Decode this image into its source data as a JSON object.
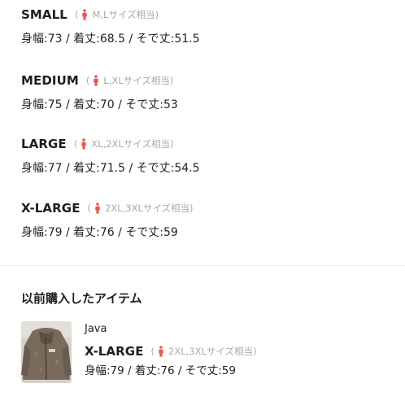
{
  "sizes": [
    {
      "name": "SMALL",
      "equiv_open": "(",
      "equiv_text": "M,Lサイズ相当)",
      "measurements": "身幅:73 / 着丈:68.5 / そで丈:51.5"
    },
    {
      "name": "MEDIUM",
      "equiv_open": "(",
      "equiv_text": "L,XLサイズ相当)",
      "measurements": "身幅:75 / 着丈:70 / そで丈:53"
    },
    {
      "name": "LARGE",
      "equiv_open": "(",
      "equiv_text": "XL,2XLサイズ相当)",
      "measurements": "身幅:77 / 着丈:71.5 / そで丈:54.5"
    },
    {
      "name": "X-LARGE",
      "equiv_open": "(",
      "equiv_text": "2XL,3XLサイズ相当)",
      "measurements": "身幅:79 / 着丈:76 / そで丈:59"
    }
  ],
  "previous_purchase": {
    "title": "以前購入したアイテム",
    "brand": "Java",
    "size_name": "X-LARGE",
    "equiv_open": "(",
    "equiv_text": "2XL,3XLサイズ相当)",
    "measurements": "身幅:79 / 着丈:76 / そで丈:59",
    "thumbnail_icon": "fleece-jacket-photo"
  },
  "colors": {
    "person_icon": "#e05a55",
    "muted_text": "#a9a9a9",
    "divider": "#ececec"
  }
}
